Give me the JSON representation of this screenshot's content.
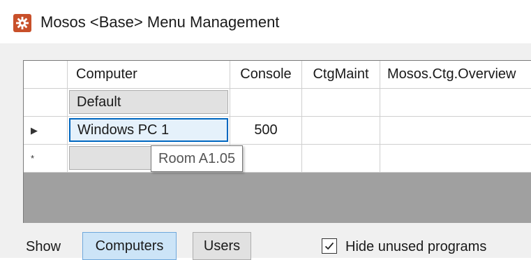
{
  "window": {
    "title": "Mosos <Base> Menu Management",
    "icon": "gear-icon",
    "icon_color": "#c8502a"
  },
  "grid": {
    "columns": [
      "",
      "Computer",
      "Console",
      "CtgMaint",
      "Mosos.Ctg.Overview"
    ],
    "rows": [
      {
        "indicator": "",
        "computer": "Default",
        "console": "",
        "ctgmaint": "",
        "overview": ""
      },
      {
        "indicator": "▶",
        "computer": "Windows PC 1",
        "console": "500",
        "ctgmaint": "",
        "overview": ""
      },
      {
        "indicator": "*",
        "computer": "",
        "console": "",
        "ctgmaint": "",
        "overview": ""
      }
    ],
    "tooltip": "Room A1.05"
  },
  "footer": {
    "show_label": "Show",
    "computers_label": "Computers",
    "users_label": "Users",
    "hide_unused_label": "Hide unused programs",
    "hide_unused_checked": true
  },
  "colors": {
    "accent": "#0067c0",
    "selected_tab": "#cce4f7"
  }
}
